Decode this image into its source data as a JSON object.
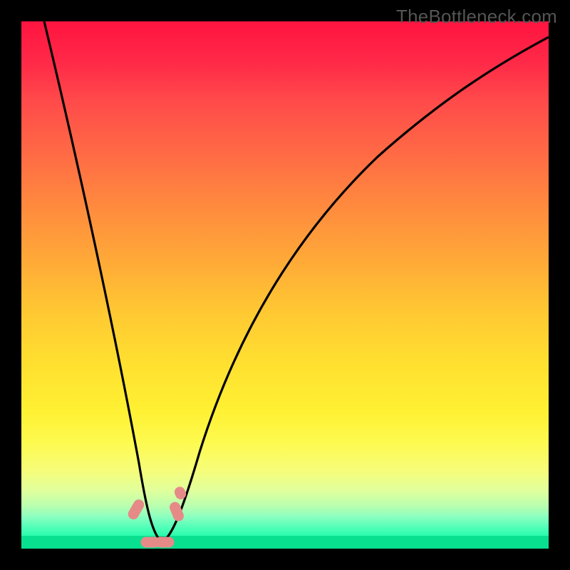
{
  "watermark": "TheBottleneck.com",
  "chart_data": {
    "type": "line",
    "title": "",
    "xlabel": "",
    "ylabel": "",
    "xlim": [
      0,
      100
    ],
    "ylim": [
      0,
      100
    ],
    "description": "V-shaped bottleneck curve over red-to-green gradient. Lower values (green) indicate optimal match; higher (red) indicate bottleneck.",
    "series": [
      {
        "name": "curve",
        "x": [
          4,
          8,
          12,
          16,
          20,
          22,
          24,
          25,
          26,
          26.5,
          27,
          28,
          29,
          30,
          32,
          36,
          42,
          50,
          60,
          70,
          80,
          90,
          100
        ],
        "values": [
          100,
          84,
          67,
          49,
          29,
          19,
          10,
          5,
          2,
          1,
          1.2,
          2,
          4,
          7,
          13,
          24,
          37,
          50,
          61,
          69,
          75,
          80,
          83
        ]
      }
    ],
    "markers": [
      {
        "x": 21.8,
        "y": 7.5,
        "w": 15,
        "h": 30,
        "rot": 30
      },
      {
        "x": 24.5,
        "y": 1.2,
        "w": 27,
        "h": 15,
        "rot": 0
      },
      {
        "x": 27.2,
        "y": 1.2,
        "w": 27,
        "h": 15,
        "rot": 0
      },
      {
        "x": 29.5,
        "y": 7.0,
        "w": 15,
        "h": 28,
        "rot": -22
      },
      {
        "x": 30.2,
        "y": 10.5,
        "w": 15,
        "h": 18,
        "rot": -25
      }
    ]
  }
}
